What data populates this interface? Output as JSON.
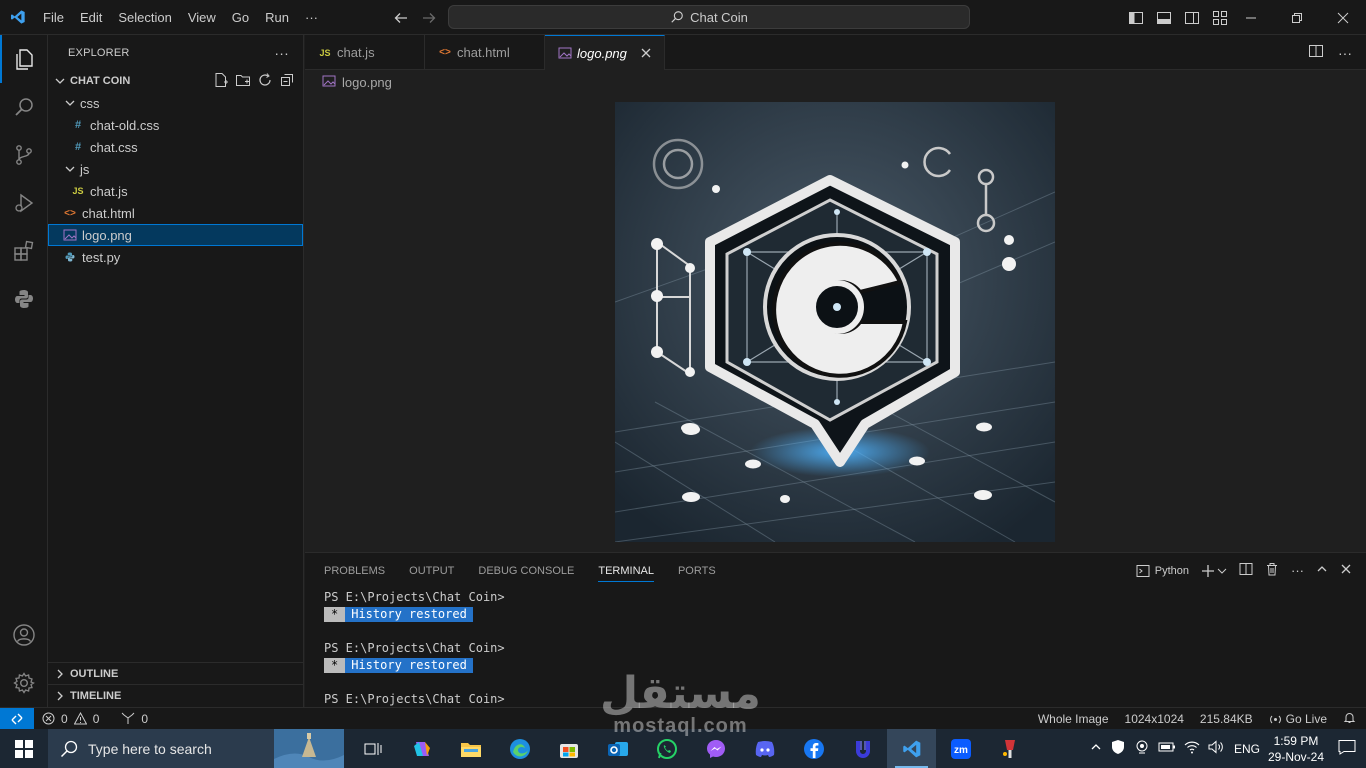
{
  "menu": [
    "File",
    "Edit",
    "Selection",
    "View",
    "Go",
    "Run",
    "···"
  ],
  "command_center": "Chat Coin",
  "explorer": {
    "title": "EXPLORER",
    "more": "···",
    "folder": "CHAT COIN",
    "items": [
      {
        "label": "css",
        "type": "folder"
      },
      {
        "label": "chat-old.css",
        "type": "css"
      },
      {
        "label": "chat.css",
        "type": "css"
      },
      {
        "label": "js",
        "type": "folder"
      },
      {
        "label": "chat.js",
        "type": "js"
      },
      {
        "label": "chat.html",
        "type": "html"
      },
      {
        "label": "logo.png",
        "type": "png"
      },
      {
        "label": "test.py",
        "type": "py"
      }
    ],
    "outline": "OUTLINE",
    "timeline": "TIMELINE"
  },
  "tabs": [
    {
      "label": "chat.js",
      "badge": "JS"
    },
    {
      "label": "chat.html",
      "badge": "<>"
    },
    {
      "label": "logo.png",
      "badge": "img"
    }
  ],
  "breadcrumb": "logo.png",
  "panel": {
    "tabs": [
      "PROBLEMS",
      "OUTPUT",
      "DEBUG CONSOLE",
      "TERMINAL",
      "PORTS"
    ],
    "active_tab": "TERMINAL",
    "shell": "Python",
    "terminal_lines": [
      "PS E:\\Projects\\Chat Coin>",
      "History restored",
      "PS E:\\Projects\\Chat Coin>",
      "History restored",
      "PS E:\\Projects\\Chat Coin>"
    ],
    "badge_star": "*"
  },
  "status": {
    "errors": "0",
    "warnings": "0",
    "ports": "0",
    "view_mode": "Whole Image",
    "dimensions": "1024x1024",
    "file_size": "215.84KB",
    "go_live": "Go Live"
  },
  "taskbar": {
    "search_placeholder": "Type here to search",
    "lang": "ENG",
    "time": "1:59 PM",
    "date": "29-Nov-24"
  },
  "watermark": {
    "arabic": "مستقل",
    "latin": "mostaql.com"
  },
  "colors": {
    "accent": "#0078d4",
    "editor_bg": "#1f1f1f",
    "sidebar_bg": "#181818",
    "taskbar_bg": "#1c2733"
  }
}
